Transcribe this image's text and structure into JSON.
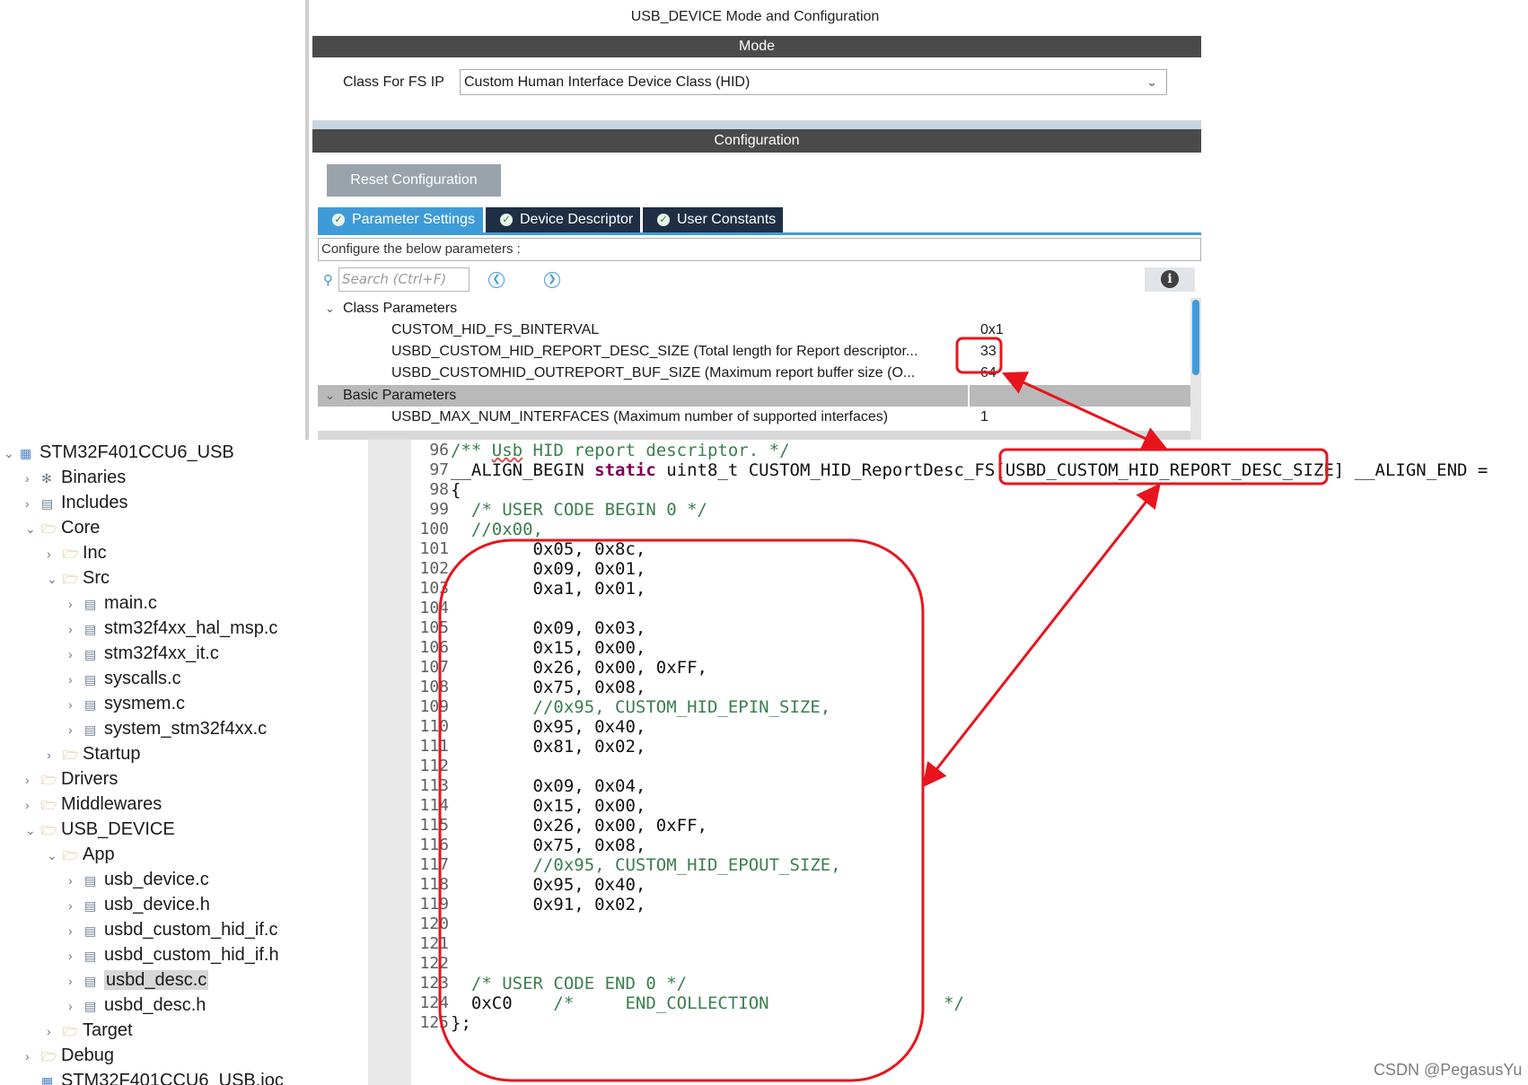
{
  "config_panel": {
    "title": "USB_DEVICE Mode and Configuration",
    "mode_header": "Mode",
    "class_label": "Class For FS IP",
    "class_value": "Custom Human Interface Device Class (HID)",
    "configuration_header": "Configuration",
    "reset_button": "Reset Configuration",
    "tabs": [
      {
        "label": "Parameter Settings",
        "active": true
      },
      {
        "label": "Device Descriptor",
        "active": false
      },
      {
        "label": "User Constants",
        "active": false
      }
    ],
    "configure_text": "Configure the below parameters :",
    "search_placeholder": "Search (Ctrl+F)",
    "groups": [
      {
        "name": "Class Parameters",
        "rows": [
          {
            "name": "CUSTOM_HID_FS_BINTERVAL",
            "value": "0x1"
          },
          {
            "name": "USBD_CUSTOM_HID_REPORT_DESC_SIZE (Total length for Report descriptor...",
            "value": "33"
          },
          {
            "name": "USBD_CUSTOMHID_OUTREPORT_BUF_SIZE (Maximum report buffer size (O...",
            "value": "64"
          }
        ]
      },
      {
        "name": "Basic Parameters",
        "rows": [
          {
            "name": "USBD_MAX_NUM_INTERFACES (Maximum number of supported interfaces)",
            "value": "1"
          }
        ]
      }
    ],
    "accent_color": "#3f9bd8"
  },
  "project_tree": {
    "items": [
      {
        "label": "STM32F401CCU6_USB",
        "depth": 0,
        "twisty": "open",
        "icon": "project-icon"
      },
      {
        "label": "Binaries",
        "depth": 1,
        "twisty": "closed",
        "icon": "binaries-icon"
      },
      {
        "label": "Includes",
        "depth": 1,
        "twisty": "closed",
        "icon": "includes-icon"
      },
      {
        "label": "Core",
        "depth": 1,
        "twisty": "open",
        "icon": "folder-icon"
      },
      {
        "label": "Inc",
        "depth": 2,
        "twisty": "closed",
        "icon": "folder-icon"
      },
      {
        "label": "Src",
        "depth": 2,
        "twisty": "open",
        "icon": "folder-icon"
      },
      {
        "label": "main.c",
        "depth": 3,
        "twisty": "closed",
        "icon": "c-file-icon"
      },
      {
        "label": "stm32f4xx_hal_msp.c",
        "depth": 3,
        "twisty": "closed",
        "icon": "c-file-icon"
      },
      {
        "label": "stm32f4xx_it.c",
        "depth": 3,
        "twisty": "closed",
        "icon": "c-file-icon"
      },
      {
        "label": "syscalls.c",
        "depth": 3,
        "twisty": "closed",
        "icon": "c-file-icon"
      },
      {
        "label": "sysmem.c",
        "depth": 3,
        "twisty": "closed",
        "icon": "c-file-icon"
      },
      {
        "label": "system_stm32f4xx.c",
        "depth": 3,
        "twisty": "closed",
        "icon": "c-file-icon"
      },
      {
        "label": "Startup",
        "depth": 2,
        "twisty": "closed",
        "icon": "folder-icon"
      },
      {
        "label": "Drivers",
        "depth": 1,
        "twisty": "closed",
        "icon": "folder-icon"
      },
      {
        "label": "Middlewares",
        "depth": 1,
        "twisty": "closed",
        "icon": "folder-icon"
      },
      {
        "label": "USB_DEVICE",
        "depth": 1,
        "twisty": "open",
        "icon": "folder-icon"
      },
      {
        "label": "App",
        "depth": 2,
        "twisty": "open",
        "icon": "folder-icon"
      },
      {
        "label": "usb_device.c",
        "depth": 3,
        "twisty": "closed",
        "icon": "c-file-icon"
      },
      {
        "label": "usb_device.h",
        "depth": 3,
        "twisty": "closed",
        "icon": "h-file-icon"
      },
      {
        "label": "usbd_custom_hid_if.c",
        "depth": 3,
        "twisty": "closed",
        "icon": "c-file-icon"
      },
      {
        "label": "usbd_custom_hid_if.h",
        "depth": 3,
        "twisty": "closed",
        "icon": "h-file-icon"
      },
      {
        "label": "usbd_desc.c",
        "depth": 3,
        "twisty": "closed",
        "icon": "c-file-icon",
        "selected": true
      },
      {
        "label": "usbd_desc.h",
        "depth": 3,
        "twisty": "closed",
        "icon": "h-file-icon"
      },
      {
        "label": "Target",
        "depth": 2,
        "twisty": "closed",
        "icon": "folder-icon"
      },
      {
        "label": "Debug",
        "depth": 1,
        "twisty": "closed",
        "icon": "folder-icon"
      },
      {
        "label": "STM32F401CCU6_USB.ioc",
        "depth": 1,
        "twisty": "none",
        "icon": "ioc-file-icon"
      }
    ]
  },
  "editor": {
    "lines": [
      {
        "num": "96",
        "segments": [
          {
            "t": "/** ",
            "c": "cmt"
          },
          {
            "t": "Usb",
            "c": "cmt tok-sq"
          },
          {
            "t": " HID report descriptor. */",
            "c": "cmt"
          }
        ]
      },
      {
        "num": "97",
        "segments": [
          {
            "t": "__ALIGN_BEGIN "
          },
          {
            "t": "static",
            "c": "kw"
          },
          {
            "t": " uint8_t CUSTOM_HID_ReportDesc_FS[USBD_CUSTOM_HID_REPORT_DESC_SIZE] __ALIGN_END ="
          }
        ]
      },
      {
        "num": "98",
        "segments": [
          {
            "t": "{"
          }
        ]
      },
      {
        "num": "99",
        "segments": [
          {
            "t": "  /* USER CODE BEGIN 0 */",
            "c": "cmt"
          }
        ]
      },
      {
        "num": "100",
        "segments": [
          {
            "t": "  //0x00,",
            "c": "cmt"
          }
        ]
      },
      {
        "num": "101",
        "segments": [
          {
            "t": "        0x05, 0x8c,"
          }
        ]
      },
      {
        "num": "102",
        "segments": [
          {
            "t": "        0x09, 0x01,"
          }
        ]
      },
      {
        "num": "103",
        "segments": [
          {
            "t": "        0xa1, 0x01,"
          }
        ]
      },
      {
        "num": "104",
        "segments": [
          {
            "t": ""
          }
        ]
      },
      {
        "num": "105",
        "segments": [
          {
            "t": "        0x09, 0x03,"
          }
        ]
      },
      {
        "num": "106",
        "segments": [
          {
            "t": "        0x15, 0x00,"
          }
        ]
      },
      {
        "num": "107",
        "segments": [
          {
            "t": "        0x26, 0x00, 0xFF,"
          }
        ]
      },
      {
        "num": "108",
        "segments": [
          {
            "t": "        0x75, 0x08,"
          }
        ]
      },
      {
        "num": "109",
        "segments": [
          {
            "t": "        //0x95, CUSTOM_HID_EPIN_SIZE,",
            "c": "cmt"
          }
        ]
      },
      {
        "num": "110",
        "segments": [
          {
            "t": "        0x95, 0x40,"
          }
        ]
      },
      {
        "num": "111",
        "segments": [
          {
            "t": "        0x81, 0x02,"
          }
        ]
      },
      {
        "num": "112",
        "segments": [
          {
            "t": ""
          }
        ]
      },
      {
        "num": "113",
        "segments": [
          {
            "t": "        0x09, 0x04,"
          }
        ]
      },
      {
        "num": "114",
        "segments": [
          {
            "t": "        0x15, 0x00,"
          }
        ]
      },
      {
        "num": "115",
        "segments": [
          {
            "t": "        0x26, 0x00, 0xFF,"
          }
        ]
      },
      {
        "num": "116",
        "segments": [
          {
            "t": "        0x75, 0x08,"
          }
        ]
      },
      {
        "num": "117",
        "segments": [
          {
            "t": "        //0x95, CUSTOM_HID_EPOUT_SIZE,",
            "c": "cmt"
          }
        ]
      },
      {
        "num": "118",
        "segments": [
          {
            "t": "        0x95, 0x40,"
          }
        ]
      },
      {
        "num": "119",
        "segments": [
          {
            "t": "        0x91, 0x02,"
          }
        ]
      },
      {
        "num": "120",
        "segments": [
          {
            "t": ""
          }
        ]
      },
      {
        "num": "121",
        "segments": [
          {
            "t": ""
          }
        ]
      },
      {
        "num": "122",
        "segments": [
          {
            "t": ""
          }
        ]
      },
      {
        "num": "123",
        "segments": [
          {
            "t": "  /* USER CODE END 0 */",
            "c": "cmt"
          }
        ]
      },
      {
        "num": "124",
        "segments": [
          {
            "t": "  0xC0"
          },
          {
            "t": "    /*     END_COLLECTION                 */",
            "c": "cmt"
          }
        ]
      },
      {
        "num": "125",
        "segments": [
          {
            "t": "};"
          }
        ]
      }
    ]
  },
  "annotation_color": "#e8141c",
  "watermark": "CSDN @PegasusYu"
}
